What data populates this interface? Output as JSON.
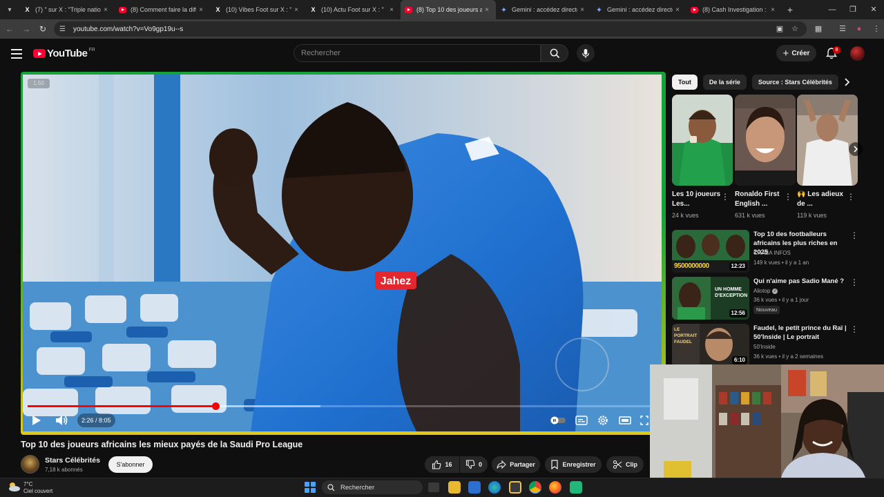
{
  "browser": {
    "tabs": [
      {
        "title": "(7) ” sur X : \"Triple nationa",
        "icon": "x-logo",
        "active": false
      },
      {
        "title": "(8) Comment faire la diffé",
        "icon": "youtube-logo",
        "active": false
      },
      {
        "title": "(10) Vibes Foot sur X : \"",
        "icon": "x-logo",
        "active": false
      },
      {
        "title": "(10) Actu Foot sur X : \"",
        "icon": "x-logo",
        "active": false
      },
      {
        "title": "(8) Top 10 des joueurs afr",
        "icon": "youtube-logo",
        "active": true
      },
      {
        "title": "Gemini : accédez directem",
        "icon": "gemini-logo",
        "active": false
      },
      {
        "title": "Gemini : accédez directem",
        "icon": "gemini-logo",
        "active": false
      },
      {
        "title": "(8) Cash Investigation : F",
        "icon": "youtube-logo",
        "active": false
      }
    ],
    "url": "youtube.com/watch?v=Vo9gp19u--s"
  },
  "header": {
    "logo_text": "YouTube",
    "country_code": "FR",
    "search_placeholder": "Rechercher",
    "create_label": "Créer",
    "notification_count": "8"
  },
  "player": {
    "speed_label": "1.50",
    "time_readout": "2:26 / 8:05",
    "progress": 0.301,
    "buffered": 0.47,
    "colors": {
      "frame_top": "#18a33a",
      "frame_bottom": "#e0c81a",
      "progress": "#ff0000"
    }
  },
  "video": {
    "title": "Top 10 des joueurs africains les mieux payés de la Saudi Pro League",
    "channel_name": "Stars Célébrités",
    "subscribers": "7,18 k abonnés",
    "subscribe_label": "S'abonner",
    "likes": "16",
    "dislikes": "0",
    "share_label": "Partager",
    "save_label": "Enregistrer",
    "clip_label": "Clip"
  },
  "sidebar": {
    "chips": [
      "Tout",
      "De la série",
      "Source : Stars Célébrités"
    ],
    "shorts": [
      {
        "title": "Les 10 joueurs Les...",
        "views": "24 k vues"
      },
      {
        "title": "Ronaldo First English ...",
        "views": "631 k vues"
      },
      {
        "title": "🙌 Les adieux de ...",
        "views": "119 k vues"
      }
    ],
    "recommendations": [
      {
        "title": "Top 10 des footballeurs africains les plus riches en 2025",
        "channel": "CHABA INFOS",
        "meta": "149 k vues • il y a 1 an",
        "duration": "12:23",
        "thumb_text": "9500000000",
        "badge": ""
      },
      {
        "title": "Qui n'aime pas Sadio Mané ?",
        "channel": "Aliotop",
        "meta": "36 k vues • il y a 1 jour",
        "duration": "12:56",
        "thumb_text": "UN HOMME D'EXCEPTION",
        "badge": "Nouveau"
      },
      {
        "title": "Faudel, le petit prince du Raï | 50'Inside | Le portrait",
        "channel": "50'Inside",
        "meta": "36 k vues • il y a 2 semaines",
        "duration": "6:10",
        "thumb_text": "LE PORTRAIT FAUDEL",
        "badge": ""
      }
    ]
  },
  "taskbar": {
    "temperature": "7°C",
    "weather": "Ciel couvert",
    "search_label": "Rechercher"
  }
}
